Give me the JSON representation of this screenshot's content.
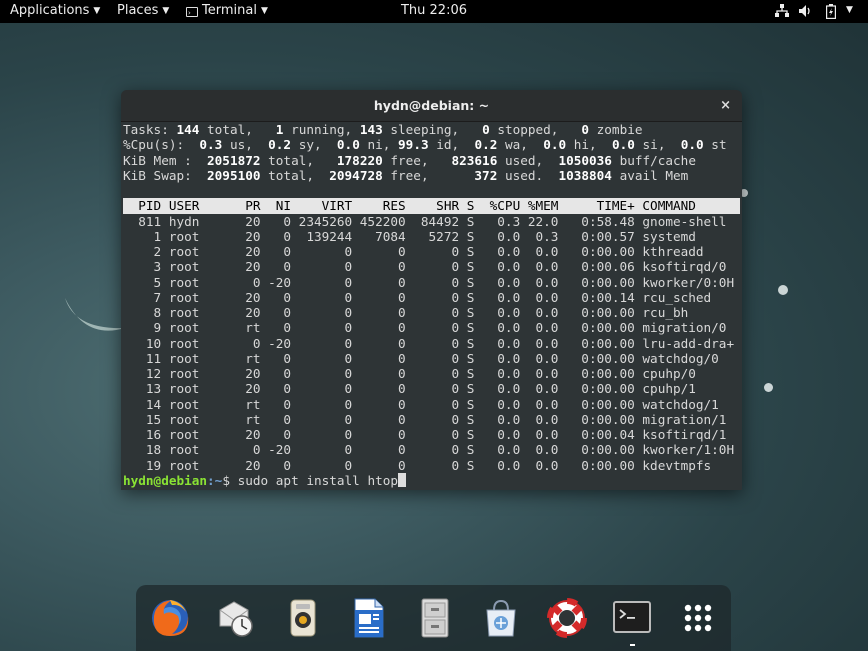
{
  "topbar": {
    "applications": "Applications",
    "places": "Places",
    "terminal": "Terminal",
    "clock": "Thu 22:06",
    "tray_icons": [
      "network-icon",
      "volume-icon",
      "battery-icon",
      "power-menu-arrow"
    ]
  },
  "window": {
    "title": "hydn@debian: ~",
    "close": "×"
  },
  "top_summary": {
    "tasks": [
      "Tasks: ",
      "144",
      " total,   ",
      "1",
      " running, ",
      "143",
      " sleeping,   ",
      "0",
      " stopped,   ",
      "0",
      " zombie"
    ],
    "cpu": [
      "%Cpu(s):  ",
      "0.3",
      " us,  ",
      "0.2",
      " sy,  ",
      "0.0",
      " ni, ",
      "99.3",
      " id,  ",
      "0.2",
      " wa,  ",
      "0.0",
      " hi,  ",
      "0.0",
      " si,  ",
      "0.0",
      " st"
    ],
    "mem": [
      "KiB Mem :  ",
      "2051872",
      " total,   ",
      "178220",
      " free,   ",
      "823616",
      " used,  ",
      "1050036",
      " buff/cache"
    ],
    "swap": [
      "KiB Swap:  ",
      "2095100",
      " total,  ",
      "2094728",
      " free,      ",
      "372",
      " used.  ",
      "1038804",
      " avail Mem"
    ]
  },
  "table": {
    "header": "  PID USER      PR  NI    VIRT    RES    SHR S  %CPU %MEM     TIME+ COMMAND",
    "rows": [
      "  811 hydn      20   0 2345260 452200  84492 S   0.3 22.0   0:58.48 gnome-shell",
      "    1 root      20   0  139244   7084   5272 S   0.0  0.3   0:00.57 systemd",
      "    2 root      20   0       0      0      0 S   0.0  0.0   0:00.00 kthreadd",
      "    3 root      20   0       0      0      0 S   0.0  0.0   0:00.06 ksoftirqd/0",
      "    5 root       0 -20       0      0      0 S   0.0  0.0   0:00.00 kworker/0:0H",
      "    7 root      20   0       0      0      0 S   0.0  0.0   0:00.14 rcu_sched",
      "    8 root      20   0       0      0      0 S   0.0  0.0   0:00.00 rcu_bh",
      "    9 root      rt   0       0      0      0 S   0.0  0.0   0:00.00 migration/0",
      "   10 root       0 -20       0      0      0 S   0.0  0.0   0:00.00 lru-add-dra+",
      "   11 root      rt   0       0      0      0 S   0.0  0.0   0:00.00 watchdog/0",
      "   12 root      20   0       0      0      0 S   0.0  0.0   0:00.00 cpuhp/0",
      "   13 root      20   0       0      0      0 S   0.0  0.0   0:00.00 cpuhp/1",
      "   14 root      rt   0       0      0      0 S   0.0  0.0   0:00.00 watchdog/1",
      "   15 root      rt   0       0      0      0 S   0.0  0.0   0:00.00 migration/1",
      "   16 root      20   0       0      0      0 S   0.0  0.0   0:00.04 ksoftirqd/1",
      "   18 root       0 -20       0      0      0 S   0.0  0.0   0:00.00 kworker/1:0H",
      "   19 root      20   0       0      0      0 S   0.0  0.0   0:00.00 kdevtmpfs"
    ]
  },
  "prompt": {
    "user_host": "hydn@debian",
    "path": ":~",
    "symbol": "$ ",
    "command": "sudo apt install htop"
  },
  "dock": {
    "items": [
      {
        "name": "firefox-icon",
        "running": false
      },
      {
        "name": "evolution-mail-icon",
        "running": false
      },
      {
        "name": "rhythmbox-icon",
        "running": false
      },
      {
        "name": "libreoffice-writer-icon",
        "running": false
      },
      {
        "name": "files-icon",
        "running": false
      },
      {
        "name": "software-icon",
        "running": false
      },
      {
        "name": "help-icon",
        "running": false
      },
      {
        "name": "terminal-icon",
        "running": true
      },
      {
        "name": "show-applications-icon",
        "running": false
      }
    ]
  },
  "colors": {
    "terminal_bg": "#2e3436",
    "prompt_user": "#8ae234",
    "prompt_path": "#729fcf"
  }
}
